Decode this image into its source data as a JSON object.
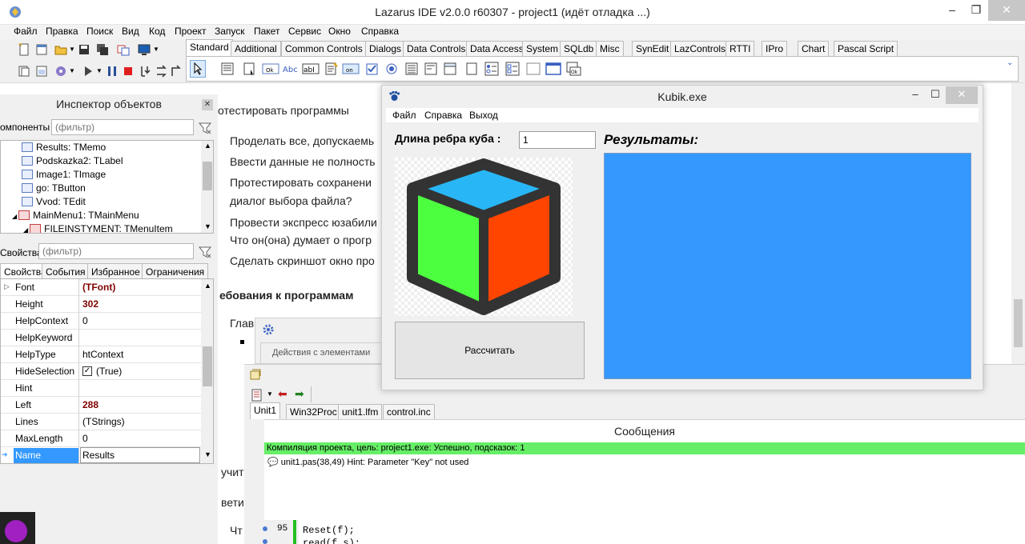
{
  "ide": {
    "title": "Lazarus IDE v2.0.0 r60307 - project1 (идёт отладка ...)",
    "menu": [
      "Файл",
      "Правка",
      "Поиск",
      "Вид",
      "Код",
      "Проект",
      "Запуск",
      "Пакет",
      "Сервис",
      "Окно",
      "Справка"
    ],
    "palette_tabs": [
      "Standard",
      "Additional",
      "Common Controls",
      "Dialogs",
      "Data Controls",
      "Data Access",
      "System",
      "SQLdb",
      "Misc",
      "SynEdit",
      "LazControls",
      "RTTI",
      "IPro",
      "Chart",
      "Pascal Script"
    ],
    "active_palette_tab": "Standard"
  },
  "inspector": {
    "title": "Инспектор объектов",
    "components_label": "омпоненты",
    "components_filter_placeholder": "(фильтр)",
    "tree": [
      "Results: TMemo",
      "Podskazka2: TLabel",
      "Image1: TImage",
      "go: TButton",
      "Vvod: TEdit",
      "MainMenu1: TMainMenu",
      "FILEINSTYMENT: TMenuItem"
    ],
    "props_label": "Свойства",
    "props_filter_placeholder": "(фильтр)",
    "tabs": [
      "Свойства",
      "События",
      "Избранное",
      "Ограничения"
    ],
    "properties": [
      {
        "name": "Font",
        "value": "(TFont)",
        "modified": true
      },
      {
        "name": "Height",
        "value": "302",
        "modified": true
      },
      {
        "name": "HelpContext",
        "value": "0",
        "modified": false
      },
      {
        "name": "HelpKeyword",
        "value": "",
        "modified": false
      },
      {
        "name": "HelpType",
        "value": "htContext",
        "modified": false
      },
      {
        "name": "HideSelection",
        "value": "(True)",
        "modified": false
      },
      {
        "name": "Hint",
        "value": "",
        "modified": false
      },
      {
        "name": "Left",
        "value": "288",
        "modified": true
      },
      {
        "name": "Lines",
        "value": "(TStrings)",
        "modified": false
      },
      {
        "name": "MaxLength",
        "value": "0",
        "modified": false
      },
      {
        "name": "Name",
        "value": "Results",
        "modified": false
      }
    ]
  },
  "document": {
    "lines": [
      "отестировать программы",
      "Проделать все, допускаемь",
      "Ввести данные не полность",
      "Протестировать сохранени",
      "диалог выбора файла?",
      "Провести экспресс юзабили",
      "Что он(она) думает о прогр",
      "Сделать скриншот окно про",
      "ебования к программам",
      "Глав",
      "учит",
      "вети",
      "Чт"
    ]
  },
  "kubik": {
    "title": "Kubik.exe",
    "menu": [
      "Файл",
      "Справка",
      "Выход"
    ],
    "edge_label": "Длина ребра куба :",
    "edge_value": "1",
    "results_label": "Результаты:",
    "calc_button": "Рассчитать",
    "cube_colors": {
      "top": "#29b6f6",
      "left": "#4cff3f",
      "right": "#ff4500",
      "outline": "#333333"
    },
    "results_bg": "#3399ff"
  },
  "actions_window": {
    "label": "Действия с элементами"
  },
  "source_tabs": [
    "Unit1",
    "Win32Proc",
    "unit1.lfm",
    "control.inc"
  ],
  "messages": {
    "title": "Сообщения",
    "success": "Компиляция проекта, цель: project1.exe: Успешно, подсказок: 1",
    "hint": "unit1.pas(38,49) Hint: Parameter \"Key\" not used"
  },
  "code": {
    "line_number": "95",
    "line1": "Reset(f);",
    "line2": "read(f,s);"
  }
}
